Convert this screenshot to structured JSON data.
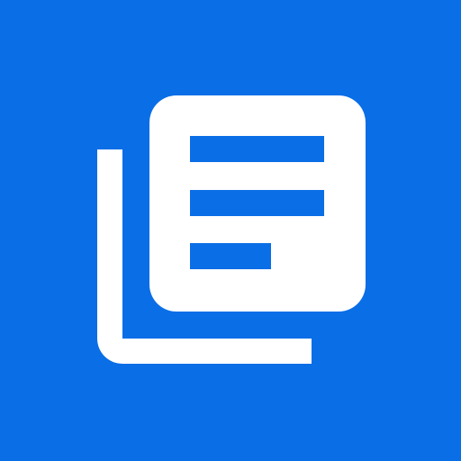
{
  "app_icon": {
    "icon": "document-stack-icon",
    "colors": {
      "background": "#0A6EE6",
      "foreground": "#FFFFFF",
      "lines": "#0A6EE6"
    }
  }
}
